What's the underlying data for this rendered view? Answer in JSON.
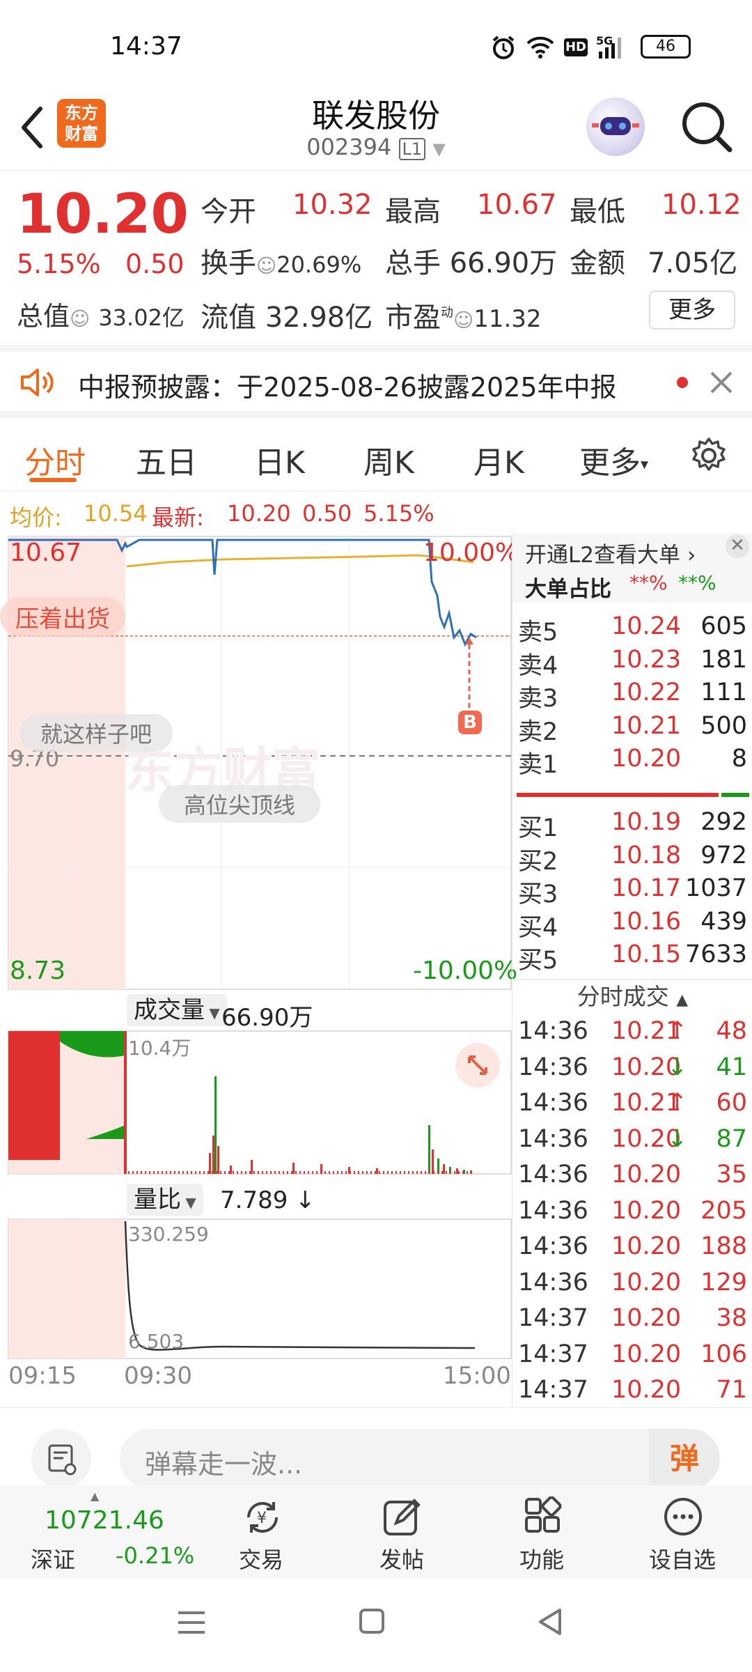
{
  "status": {
    "time": "14:37",
    "battery": "46"
  },
  "header": {
    "title": "联发股份",
    "code": "002394",
    "level": "L1",
    "logo_line1": "东方",
    "logo_line2": "财富"
  },
  "quote": {
    "price": "10.20",
    "change_pct": "5.15%",
    "change_amt": "0.50",
    "open_label": "今开",
    "open": "10.32",
    "high_label": "最高",
    "high": "10.67",
    "low_label": "最低",
    "low": "10.12",
    "turnover_label": "换手",
    "turnover": "20.69%",
    "volume_label": "总手",
    "volume": "66.90万",
    "amount_label": "金额",
    "amount": "7.05亿",
    "mktcap_label": "总值",
    "mktcap": "33.02亿",
    "float_label": "流值",
    "float": "32.98亿",
    "pe_label": "市盈",
    "pe_sup": "动",
    "pe": "11.32",
    "more": "更多"
  },
  "notice": {
    "text": "中报预披露：于2025-08-26披露2025年中报"
  },
  "tabs": [
    "分时",
    "五日",
    "日K",
    "周K",
    "月K",
    "更多"
  ],
  "summary": {
    "avg_label": "均价:",
    "avg": "10.54",
    "last_label": "最新:",
    "last": "10.20",
    "chg": "0.50",
    "pct": "5.15%"
  },
  "chart": {
    "y_top": "10.67",
    "y_mid": "9.70",
    "y_bottom": "8.73",
    "pct_top": "10.00%",
    "pct_bottom": "-10.00%",
    "danmu1": "压着出货",
    "danmu2": "就这样子吧",
    "danmu3": "高位尖顶线",
    "marker": "B",
    "watermark": "东方财富",
    "vol_label": "成交量",
    "vol_value": "66.90万",
    "vol_max": "10.4万",
    "ratio_label": "量比",
    "ratio_value": "7.789 ↓",
    "ratio_max": "330.259",
    "ratio_min": "6.503",
    "t_start": "09:15",
    "t_open": "09:30",
    "t_end": "15:00"
  },
  "book": {
    "promo": "开通L2查看大单 ›",
    "big_label": "大单占比",
    "big_red": "**%",
    "big_green": "**%",
    "asks": [
      {
        "label": "卖5",
        "price": "10.24",
        "vol": "605"
      },
      {
        "label": "卖4",
        "price": "10.23",
        "vol": "181"
      },
      {
        "label": "卖3",
        "price": "10.22",
        "vol": "111"
      },
      {
        "label": "卖2",
        "price": "10.21",
        "vol": "500"
      },
      {
        "label": "卖1",
        "price": "10.20",
        "vol": "8"
      }
    ],
    "bids": [
      {
        "label": "买1",
        "price": "10.19",
        "vol": "292"
      },
      {
        "label": "买2",
        "price": "10.18",
        "vol": "972"
      },
      {
        "label": "买3",
        "price": "10.17",
        "vol": "1037"
      },
      {
        "label": "买4",
        "price": "10.16",
        "vol": "439"
      },
      {
        "label": "买5",
        "price": "10.15",
        "vol": "7633"
      }
    ],
    "trades_label": "分时成交",
    "trades": [
      {
        "time": "14:36",
        "price": "10.21",
        "dir": "↑",
        "vol": "48",
        "color": "red"
      },
      {
        "time": "14:36",
        "price": "10.20",
        "dir": "↓",
        "vol": "41",
        "color": "green"
      },
      {
        "time": "14:36",
        "price": "10.21",
        "dir": "↑",
        "vol": "60",
        "color": "red"
      },
      {
        "time": "14:36",
        "price": "10.20",
        "dir": "↓",
        "vol": "87",
        "color": "green"
      },
      {
        "time": "14:36",
        "price": "10.20",
        "dir": "",
        "vol": "35",
        "color": "red"
      },
      {
        "time": "14:36",
        "price": "10.20",
        "dir": "",
        "vol": "205",
        "color": "red"
      },
      {
        "time": "14:36",
        "price": "10.20",
        "dir": "",
        "vol": "188",
        "color": "red"
      },
      {
        "time": "14:36",
        "price": "10.20",
        "dir": "",
        "vol": "129",
        "color": "red"
      },
      {
        "time": "14:37",
        "price": "10.20",
        "dir": "",
        "vol": "38",
        "color": "red"
      },
      {
        "time": "14:37",
        "price": "10.20",
        "dir": "",
        "vol": "106",
        "color": "red"
      },
      {
        "time": "14:37",
        "price": "10.20",
        "dir": "",
        "vol": "71",
        "color": "red"
      }
    ]
  },
  "comment": {
    "placeholder": "弹幕走一波...",
    "send": "弹"
  },
  "nav": {
    "index_value": "10721.46",
    "index_name": "深证",
    "index_pct": "-0.21%",
    "trade": "交易",
    "post": "发帖",
    "func": "功能",
    "watch": "设自选"
  },
  "colors": {
    "red": "#e03030",
    "green": "#1a9a1a",
    "orange": "#f06a1e"
  }
}
